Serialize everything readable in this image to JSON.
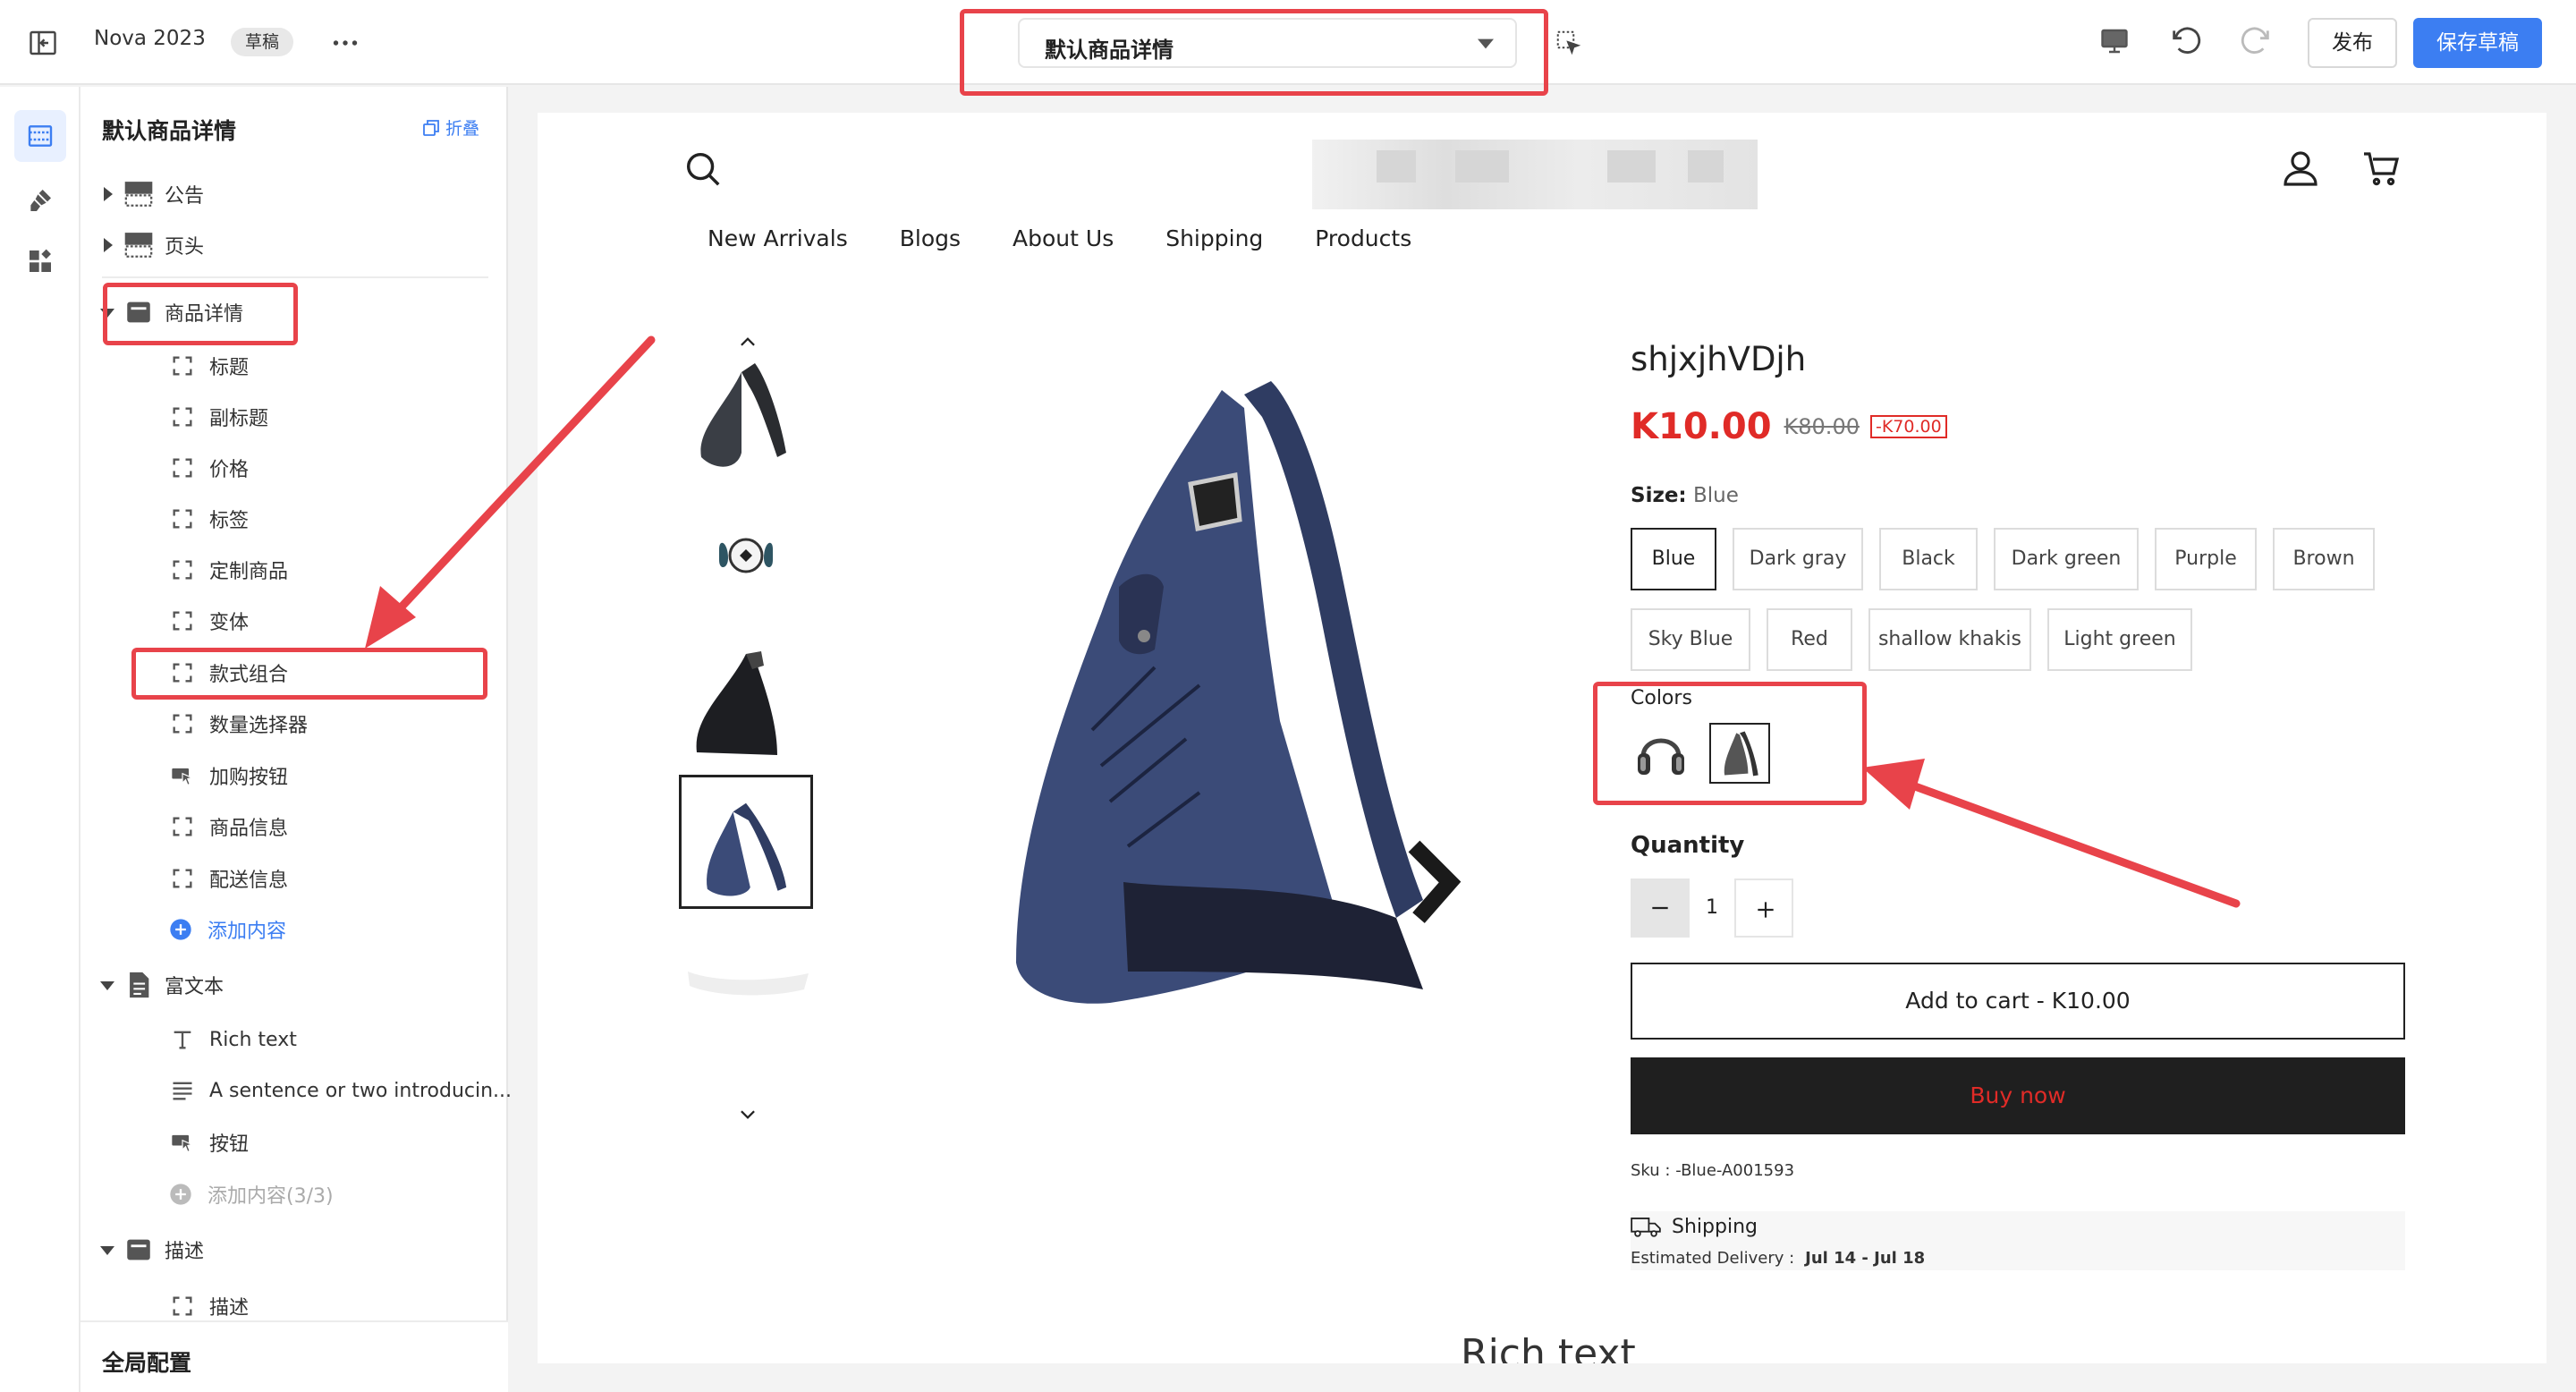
{
  "topbar": {
    "app_title": "Nova 2023",
    "draft_badge": "草稿",
    "template_select": "默认商品详情",
    "publish_label": "发布",
    "save_draft_label": "保存草稿"
  },
  "rail": {
    "icons": [
      "sections-icon",
      "theme-brush-icon",
      "apps-icon"
    ]
  },
  "sidebar": {
    "title": "默认商品详情",
    "collapse_label": "折叠",
    "sections": [
      {
        "label": "公告",
        "expanded": false
      },
      {
        "label": "页头",
        "expanded": false
      },
      {
        "label": "商品详情",
        "expanded": true,
        "blocks": [
          "标题",
          "副标题",
          "价格",
          "标签",
          "定制商品",
          "变体",
          "款式组合",
          "数量选择器",
          "加购按钮",
          "商品信息",
          "配送信息"
        ],
        "add_label": "添加内容"
      },
      {
        "label": "富文本",
        "expanded": true,
        "blocks": [
          "Rich text",
          "A sentence or two introducin...",
          "按钮"
        ],
        "add_label": "添加内容(3/3)"
      },
      {
        "label": "描述",
        "expanded": true,
        "blocks": [
          "描述"
        ]
      }
    ],
    "footer_label": "全局配置"
  },
  "store": {
    "nav": [
      "New Arrivals",
      "Blogs",
      "About Us",
      "Shipping",
      "Products"
    ]
  },
  "product": {
    "title": "shjxjhVDjh",
    "price": "K10.00",
    "compare_price": "K80.00",
    "discount": "-K70.00",
    "size_label": "Size:",
    "size_selected": "Blue",
    "sizes": [
      "Blue",
      "Dark gray",
      "Black",
      "Dark green",
      "Purple",
      "Brown",
      "Sky Blue",
      "Red",
      "shallow khakis",
      "Light green"
    ],
    "colors_label": "Colors",
    "color_swatches": [
      "headphones-swatch",
      "sling-bag-swatch"
    ],
    "quantity_label": "Quantity",
    "quantity": "1",
    "add_to_cart": "Add to cart  -  K10.00",
    "buy_now": "Buy now",
    "sku": "Sku : -Blue-A001593",
    "shipping_title": "Shipping",
    "estimated_label": "Estimated Delivery :",
    "estimated_range": "Jul 14 - Jul 18",
    "product_color": "#3b4b78"
  },
  "rich_text_heading": "Rich text",
  "colors": {
    "accent": "#3c7ef2",
    "annotation": "#e8434a",
    "sale": "#e02b27"
  }
}
